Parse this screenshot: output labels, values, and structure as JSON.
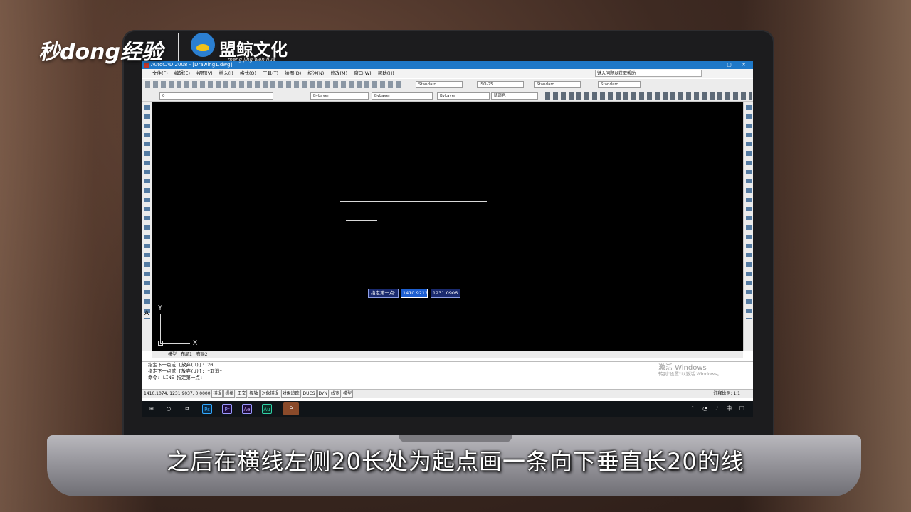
{
  "overlay": {
    "brand_logo": "秒dong经验",
    "partner_name": "盟鲸文化",
    "partner_tagline": "meng jing wen hua",
    "caption": "之后在横线左侧20长处为起点画一条向下垂直长20的线"
  },
  "window": {
    "title": "AutoCAD 2008 - [Drawing1.dwg]",
    "help_placeholder": "键入问题以获取帮助"
  },
  "menu": [
    "文件(F)",
    "编辑(E)",
    "视图(V)",
    "插入(I)",
    "格式(O)",
    "工具(T)",
    "绘图(D)",
    "标注(N)",
    "修改(M)",
    "窗口(W)",
    "帮助(H)"
  ],
  "toolbars": {
    "text_style": "Standard",
    "dim_style": "ISO-25",
    "table_style": "Standard",
    "ml_style": "Standard",
    "layer": "0",
    "color": "ByLayer",
    "linetype": "ByLayer",
    "lineweight": "ByLayer",
    "plot_style": "随颜色"
  },
  "canvas": {
    "background": "#000000",
    "ucs_x": "X",
    "ucs_y": "Y",
    "dyn_prompt": "指定第一点:",
    "dyn_x": "1410.9212",
    "dyn_y": "1231.0906"
  },
  "layout_tabs": [
    "模型",
    "布局1",
    "布局2"
  ],
  "command": {
    "lines": [
      "指定下一点或 [放弃(U)]: 20",
      "指定下一点或 [放弃(U)]: *取消*",
      "命令: LINE 指定第一点:"
    ],
    "watermark_title": "激活 Windows",
    "watermark_sub": "转到\"设置\"以激活 Windows。"
  },
  "status": {
    "coords": "1410.1074, 1231.9037, 0.0000",
    "toggles": [
      "捕捉",
      "栅格",
      "正交",
      "极轴",
      "对象捕捉",
      "对象追踪",
      "DUCS",
      "DYN",
      "线宽",
      "模型"
    ],
    "annotation_scale": "注释比例: 1:1"
  },
  "taskbar": {
    "apps": [
      "Ps",
      "Pr",
      "Ae",
      "Au"
    ]
  }
}
